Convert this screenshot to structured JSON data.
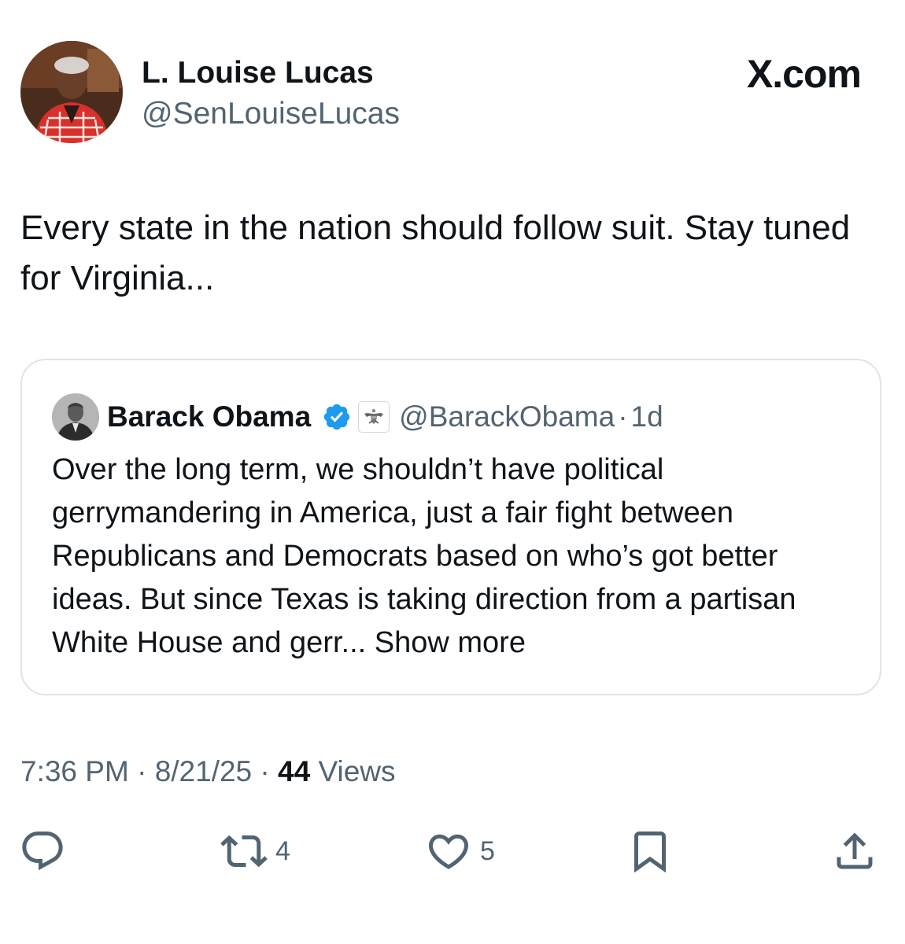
{
  "author": {
    "name": "L. Louise Lucas",
    "handle": "@SenLouiseLucas"
  },
  "site_label": "X.com",
  "tweet": {
    "text": "Every state in the nation should follow suit.  Stay tuned for Virginia..."
  },
  "quote": {
    "name": "Barack Obama",
    "handle": "@BarackObama",
    "separator": "·",
    "time": "1d",
    "text": "Over the long term, we shouldn’t have political gerrymandering in America, just a fair fight between Republicans and Democrats based on who’s got better ideas. But since Texas is taking direction from a partisan White House and gerr...",
    "show_more": "Show more"
  },
  "meta": {
    "time": "7:36 PM",
    "date": "8/21/25",
    "separator": "·",
    "views_count": "44",
    "views_label": "Views"
  },
  "actions": {
    "reply_count": "",
    "repost_count": "4",
    "like_count": "5"
  },
  "colors": {
    "text": "#0f1419",
    "secondary": "#536471",
    "verified": "#1d9bf0",
    "card_border": "#dfe4e8"
  },
  "icons": [
    "reply-icon",
    "repost-icon",
    "like-icon",
    "bookmark-icon",
    "share-icon",
    "verified-badge-icon",
    "affiliate-seal-icon"
  ]
}
